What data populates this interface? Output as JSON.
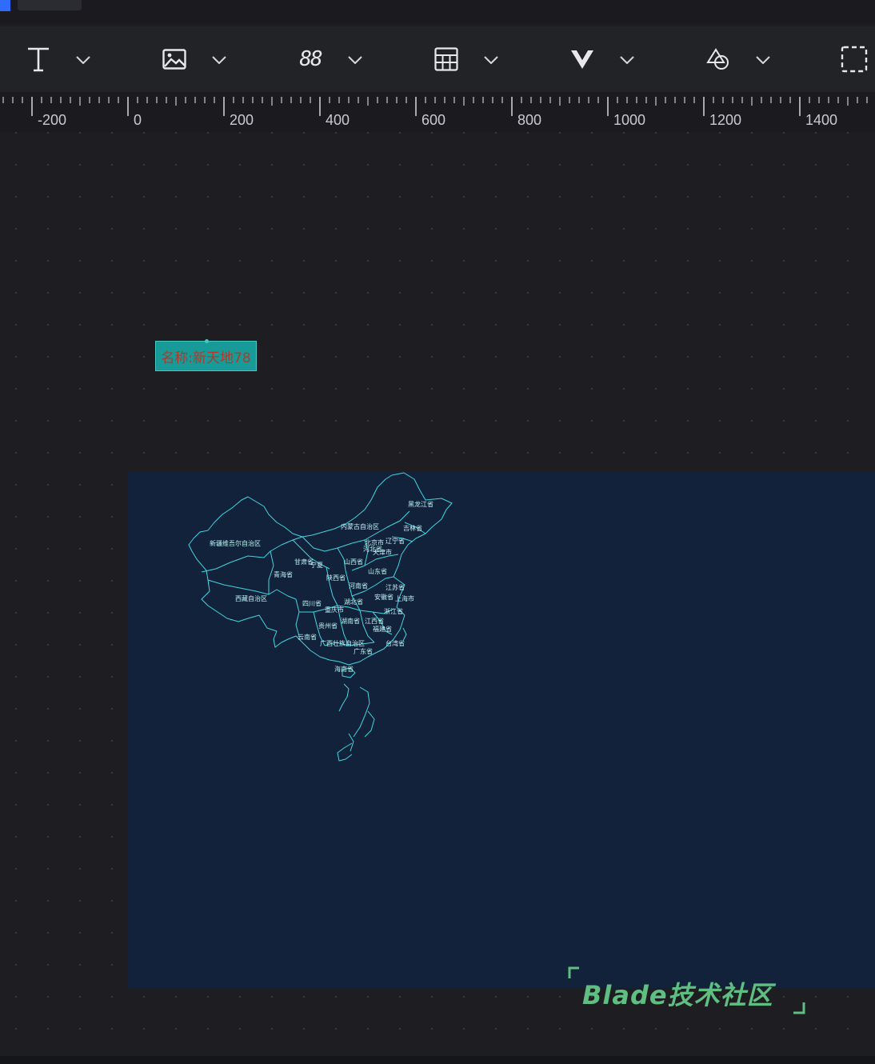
{
  "toolbar": {
    "tools": [
      {
        "name": "text-tool",
        "icon": "text-icon"
      },
      {
        "name": "image-tool",
        "icon": "image-icon"
      },
      {
        "name": "number-tool",
        "icon": "digital-number-icon",
        "glyph": "88"
      },
      {
        "name": "table-tool",
        "icon": "table-icon"
      },
      {
        "name": "vue-component-tool",
        "icon": "vue-icon"
      },
      {
        "name": "shape-tool",
        "icon": "shapes-icon"
      },
      {
        "name": "fullscreen-tool",
        "icon": "fullscreen-icon"
      }
    ]
  },
  "ruler": {
    "labels": [
      "-200",
      "0",
      "200",
      "400",
      "600",
      "800",
      "1000",
      "1200",
      "1400"
    ]
  },
  "canvas": {
    "tag_label": "名称:新天地78",
    "map": {
      "regions": [
        "新疆维吾尔自治区",
        "西藏自治区",
        "青海省",
        "甘肃省",
        "内蒙古自治区",
        "黑龙江省",
        "吉林省",
        "辽宁省",
        "宁夏",
        "陕西省",
        "山西省",
        "河北省",
        "北京市",
        "天津市",
        "山东省",
        "河南省",
        "湖北省",
        "四川省",
        "重庆市",
        "贵州省",
        "云南省",
        "广西壮族自治区",
        "广东省",
        "海南省",
        "湖南省",
        "江西省",
        "安徽省",
        "江苏省",
        "浙江省",
        "福建省",
        "上海市",
        "台湾省"
      ]
    }
  },
  "watermark": {
    "text": "Blade技术社区"
  },
  "colors": {
    "background": "#1e1e22",
    "map_background": "#11223a",
    "map_stroke": "#3fd6e0",
    "tag_fill": "#179a98",
    "tag_text": "#b03a2a",
    "watermark": "#5fbf82",
    "accent": "#2f6bff"
  }
}
